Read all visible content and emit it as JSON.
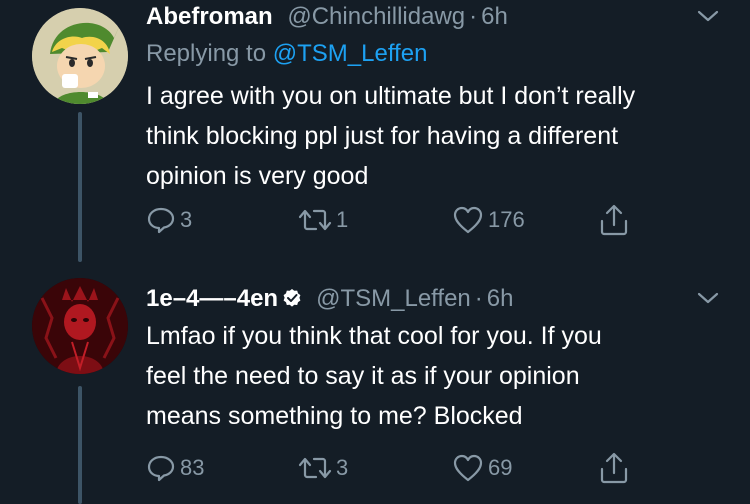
{
  "tweets": [
    {
      "display_name": "Abefroman",
      "handle": "@Chinchillidawg",
      "separator": "·",
      "time": "6h",
      "replying_prefix": "Replying to",
      "replying_to": "@TSM_Leffen",
      "lines": [
        "I agree with you on ultimate but I don’t really",
        "think blocking ppl just for having a different",
        "opinion is very good"
      ],
      "replies": "3",
      "retweets": "1",
      "likes": "176"
    },
    {
      "display_name": "1e–4—–4en",
      "handle": "@TSM_Leffen",
      "separator": "·",
      "time": "6h",
      "verified": true,
      "lines": [
        "Lmfao if you think that cool for you. If you",
        "feel the need to say it as if your opinion",
        "means something to me? Blocked"
      ],
      "replies": "83",
      "retweets": "3",
      "likes": "69"
    }
  ],
  "colors": {
    "background": "#141d26",
    "muted": "#8899a6",
    "link": "#1da1f2",
    "verified": "#ffffff",
    "thread_line": "#3d5466"
  },
  "icons": [
    "comment-icon",
    "retweet-icon",
    "heart-icon",
    "share-icon",
    "chevron-down-icon",
    "verified-badge-icon"
  ]
}
